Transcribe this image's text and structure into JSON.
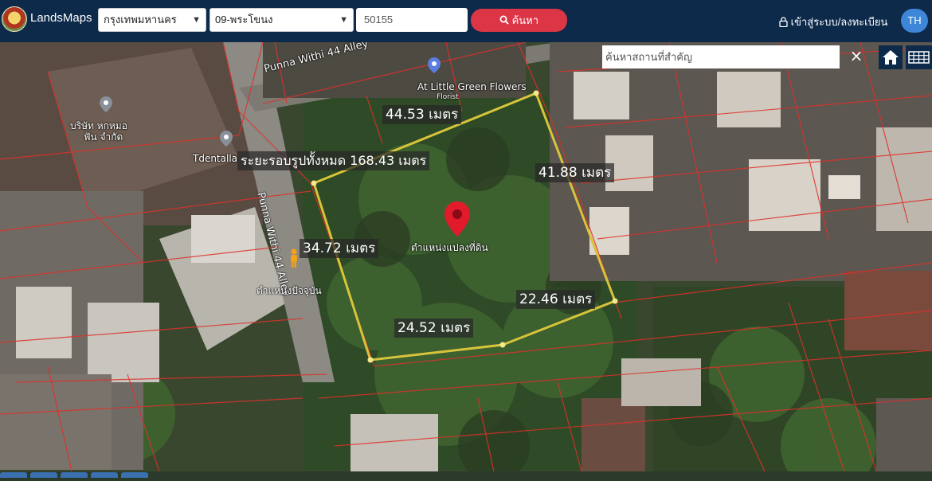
{
  "header": {
    "brand": "LandsMaps",
    "province": "กรุงเทพมหานคร",
    "district": "09-พระโขนง",
    "parcel_number": "50155",
    "search_label": "ค้นหา",
    "login_label": "เข้าสู่ระบบ/ลงทะเบียน",
    "language": "TH"
  },
  "map_tools": {
    "place_search_placeholder": "ค้นหาสถานที่สำคัญ",
    "clear_icon": "close-icon",
    "home_icon": "home-icon",
    "grid_icon": "grid-icon"
  },
  "parcel": {
    "marker_label": "ตำแหน่งแปลงที่ดิน",
    "distance_label": "ระยะรอบรูปทั้งหมด 168.43 เมตร",
    "edge_top": "44.53 เมตร",
    "edge_right": "41.88 เมตร",
    "edge_left": "34.72 เมตร",
    "edge_bottom_right": "22.46 เมตร",
    "edge_bottom": "24.52 เมตร",
    "outline_color": "#d8c43a"
  },
  "map_labels": {
    "road_top": "Punna Withi 44 Alley",
    "road_side": "Punna Withi 44 Alley",
    "poi_flowers": "At Little Green Flowers",
    "poi_flowers_sub": "Florist",
    "poi_company": "บริษัท หกหมอ",
    "poi_company_2": "ฟัน จำกัด",
    "poi_dental": "Tdentalla",
    "current_location": "ตำแหน่งปัจจุบัน"
  }
}
